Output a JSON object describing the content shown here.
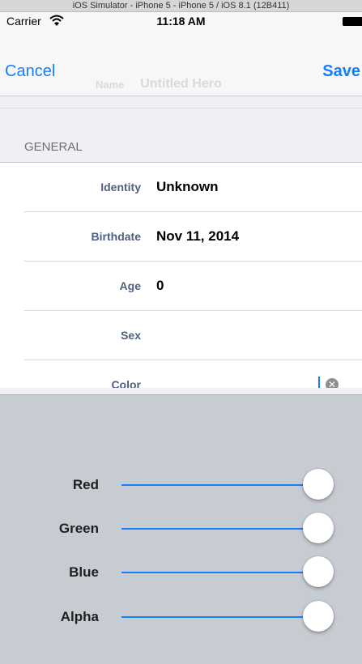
{
  "window": {
    "title": "iOS Simulator - iPhone 5 - iPhone 5 / iOS 8.1 (12B411)"
  },
  "status_bar": {
    "carrier": "Carrier",
    "time": "11:18 AM"
  },
  "nav": {
    "cancel_label": "Cancel",
    "save_label": "Save",
    "ghost_field_label": "Name",
    "ghost_title": "Untitled Hero"
  },
  "section": {
    "title": "GENERAL"
  },
  "rows": [
    {
      "label": "Identity",
      "value": "Unknown"
    },
    {
      "label": "Birthdate",
      "value": "Nov 11, 2014"
    },
    {
      "label": "Age",
      "value": "0"
    },
    {
      "label": "Sex",
      "value": ""
    },
    {
      "label": "Color",
      "value": ""
    }
  ],
  "color_picker": {
    "sliders": [
      {
        "label": "Red",
        "value": 1.0
      },
      {
        "label": "Green",
        "value": 1.0
      },
      {
        "label": "Blue",
        "value": 1.0
      },
      {
        "label": "Alpha",
        "value": 1.0
      }
    ]
  },
  "colors": {
    "accent": "#157efb",
    "background_grouped": "#efeff4",
    "picker_background": "#c7cbd2",
    "row_label": "#4f5f7e"
  }
}
